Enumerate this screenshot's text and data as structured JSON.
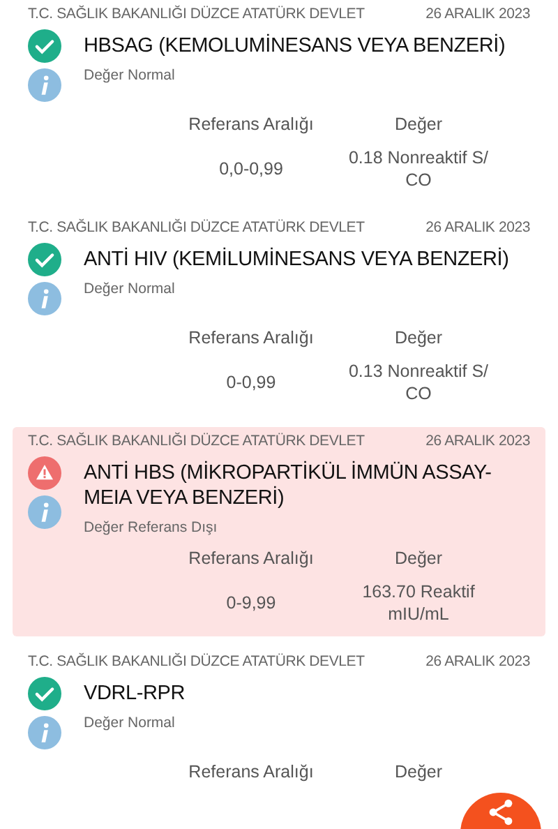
{
  "results": [
    {
      "kind": "normal",
      "institution": "T.C. SAĞLIK BAKANLIĞI DÜZCE ATATÜRK DEVLET",
      "date": "26 ARALIK 2023",
      "test": "HBSAG (KEMOLUMİNESANS VEYA BENZERİ)",
      "status": "Değer Normal",
      "reference_header": "Referans Aralığı",
      "value_header": "Değer",
      "reference": "0,0-0,99",
      "value": "0.18 Nonreaktif S/ CO"
    },
    {
      "kind": "normal",
      "institution": "T.C. SAĞLIK BAKANLIĞI DÜZCE ATATÜRK DEVLET",
      "date": "26 ARALIK 2023",
      "test": "ANTİ HIV (KEMİLUMİNESANS VEYA BENZERİ)",
      "status": "Değer Normal",
      "reference_header": "Referans Aralığı",
      "value_header": "Değer",
      "reference": "0-0,99",
      "value": "0.13 Nonreaktif S/ CO"
    },
    {
      "kind": "abnormal",
      "institution": "T.C. SAĞLIK BAKANLIĞI DÜZCE ATATÜRK DEVLET",
      "date": "26 ARALIK 2023",
      "test": "ANTİ HBS  (MİKROPARTİKÜL İMMÜN ASSAY-MEIA VEYA BENZERİ)",
      "status": "Değer Referans Dışı",
      "reference_header": "Referans Aralığı",
      "value_header": "Değer",
      "reference": "0-9,99",
      "value": "163.70 Reaktif mIU/mL"
    },
    {
      "kind": "normal",
      "institution": "T.C. SAĞLIK BAKANLIĞI DÜZCE ATATÜRK DEVLET",
      "date": "26 ARALIK 2023",
      "test": "VDRL-RPR",
      "status": "Değer Normal",
      "reference_header": "Referans Aralığı",
      "value_header": "Değer"
    }
  ]
}
